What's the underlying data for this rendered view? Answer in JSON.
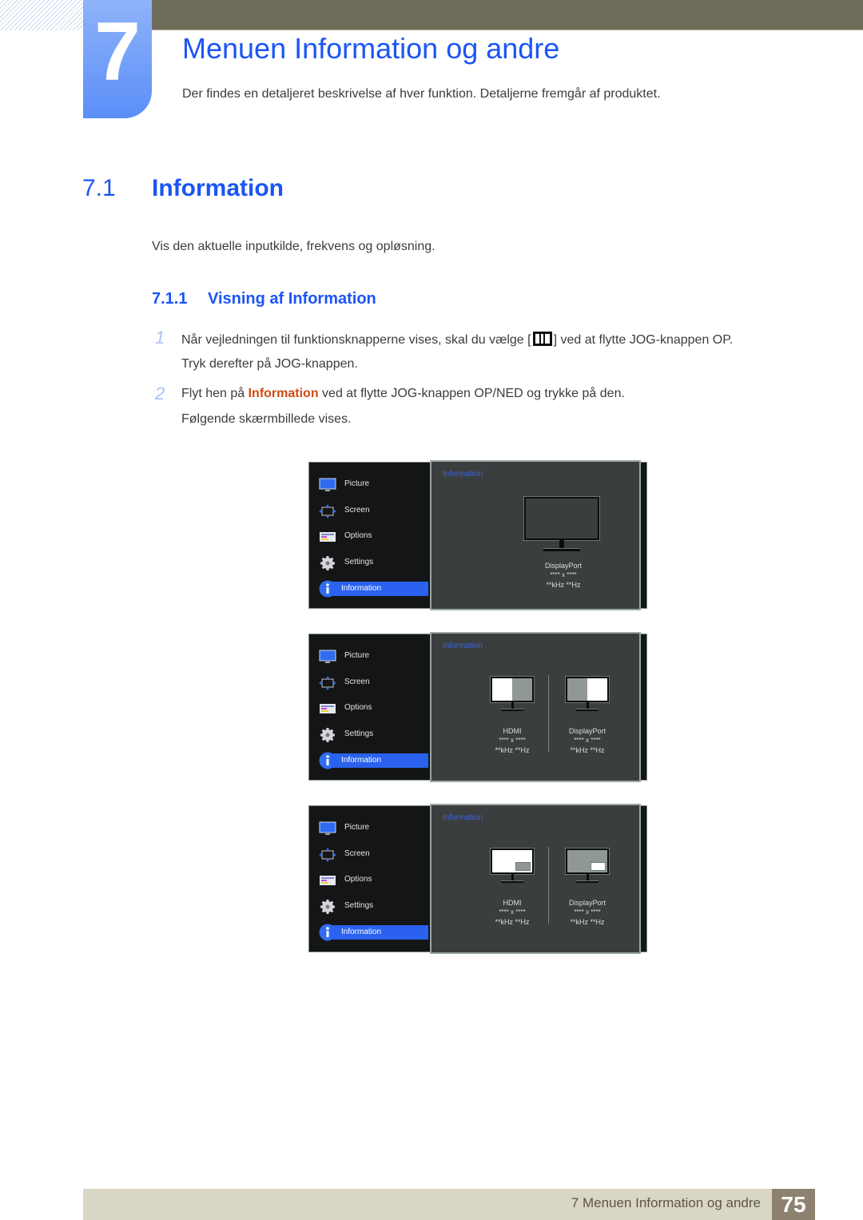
{
  "chapter": {
    "number": "7",
    "title": "Menuen Information og andre",
    "intro": "Der findes en detaljeret beskrivelse af hver funktion. Detaljerne fremgår af produktet."
  },
  "section": {
    "number": "7.1",
    "title": "Information",
    "description": "Vis den aktuelle inputkilde, frekvens og opløsning."
  },
  "subsection": {
    "number": "7.1.1",
    "title": "Visning af Information"
  },
  "steps": [
    {
      "number": "1",
      "line1_before": "Når vejledningen til funktionsknapperne vises, skal du vælge [",
      "icon": "menu-icon",
      "line1_after": "] ved at flytte JOG-knappen OP.",
      "line2": "Tryk derefter på JOG-knappen."
    },
    {
      "number": "2",
      "line1_before": "Flyt hen på ",
      "highlight": "Information",
      "line1_after": " ved at flytte JOG-knappen OP/NED og trykke på den.",
      "line2": "Følgende skærmbillede vises."
    }
  ],
  "osd": {
    "menu_items": [
      {
        "label": "Picture",
        "icon": "picture-icon"
      },
      {
        "label": "Screen",
        "icon": "screen-icon"
      },
      {
        "label": "Options",
        "icon": "options-icon"
      },
      {
        "label": "Settings",
        "icon": "settings-icon"
      },
      {
        "label": "Information",
        "icon": "info-icon",
        "active": true
      }
    ],
    "panel_title": "Information",
    "screens": [
      {
        "mode": "single",
        "sources": [
          {
            "name": "DisplayPort",
            "resolution": "**** x ****",
            "frequency": "**kHz **Hz"
          }
        ]
      },
      {
        "mode": "pbp",
        "sources": [
          {
            "name": "HDMI",
            "resolution": "**** x ****",
            "frequency": "**kHz **Hz"
          },
          {
            "name": "DisplayPort",
            "resolution": "**** x ****",
            "frequency": "**kHz **Hz"
          }
        ]
      },
      {
        "mode": "pip",
        "sources": [
          {
            "name": "HDMI",
            "resolution": "**** x ****",
            "frequency": "**kHz **Hz"
          },
          {
            "name": "DisplayPort",
            "resolution": "**** x ****",
            "frequency": "**kHz **Hz"
          }
        ]
      }
    ]
  },
  "footer": {
    "text": "7 Menuen Information og andre",
    "page": "75"
  },
  "colors": {
    "heading_blue": "#1b55f5",
    "highlight_orange": "#d04a12",
    "topbar": "#6e6b59",
    "osd_active": "#2a62ef",
    "footer_bg": "#dad6c4",
    "page_badge": "#8d8270"
  }
}
